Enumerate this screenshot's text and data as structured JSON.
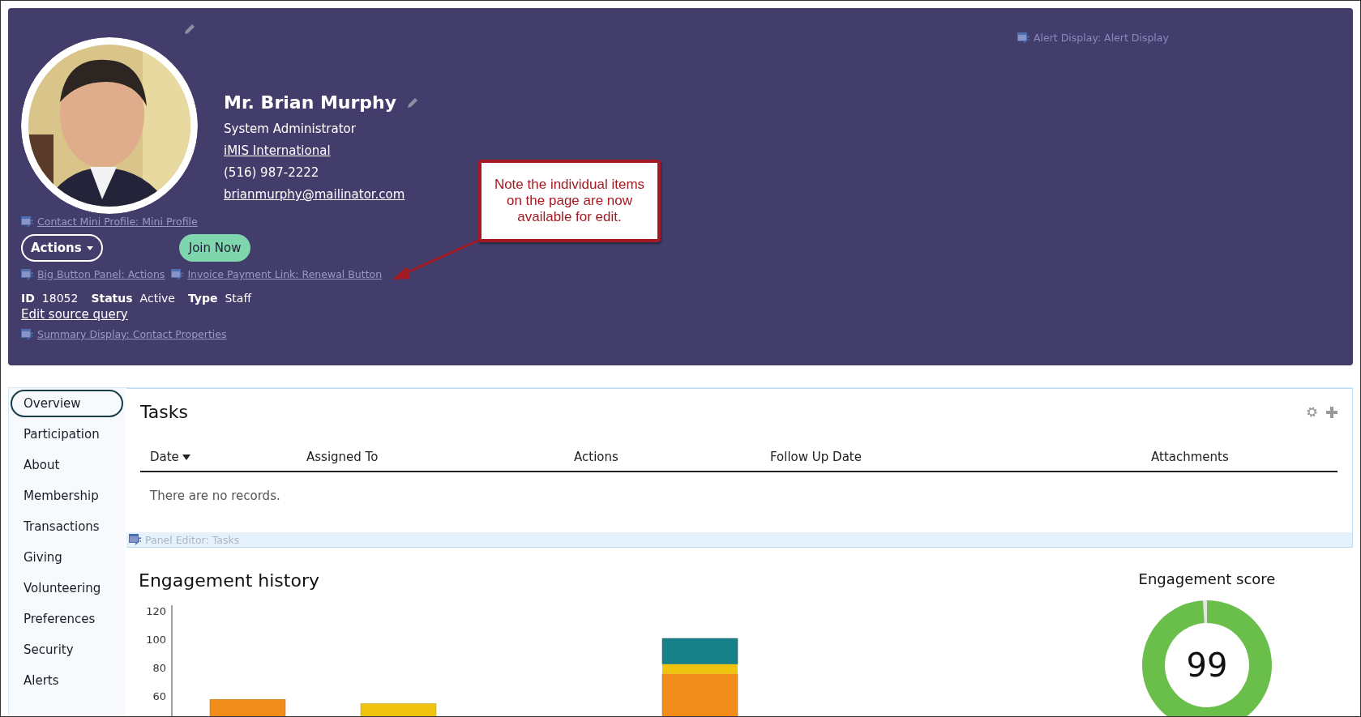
{
  "header": {
    "alert_display_link": "Alert Display: Alert Display",
    "name": "Mr. Brian Murphy",
    "job_title": "System Administrator",
    "organization": "iMIS International",
    "phone": "(516) 987-2222",
    "email": "brianmurphy@mailinator.com",
    "mini_profile_link": "Contact Mini Profile: Mini Profile",
    "actions_button": "Actions",
    "join_button": "Join Now",
    "panel_links": [
      "Big Button Panel: Actions",
      "Invoice Payment Link: Renewal Button"
    ],
    "properties": [
      {
        "label": "ID",
        "value": "18052"
      },
      {
        "label": "Status",
        "value": "Active"
      },
      {
        "label": "Type",
        "value": "Staff"
      }
    ],
    "edit_query_link": "Edit source query",
    "summary_link": "Summary Display: Contact Properties"
  },
  "callout": {
    "text": "Note the individual items on the page are now available for edit."
  },
  "nav": [
    {
      "label": "Overview",
      "selected": true
    },
    {
      "label": "Participation",
      "selected": false
    },
    {
      "label": "About",
      "selected": false
    },
    {
      "label": "Membership",
      "selected": false
    },
    {
      "label": "Transactions",
      "selected": false
    },
    {
      "label": "Giving",
      "selected": false
    },
    {
      "label": "Volunteering",
      "selected": false
    },
    {
      "label": "Preferences",
      "selected": false
    },
    {
      "label": "Security",
      "selected": false
    },
    {
      "label": "Alerts",
      "selected": false
    }
  ],
  "tasks": {
    "title": "Tasks",
    "columns": [
      {
        "label": "Date",
        "sorted": true
      },
      {
        "label": "Assigned To",
        "sorted": false
      },
      {
        "label": "Actions",
        "sorted": false
      },
      {
        "label": "Follow Up Date",
        "sorted": false
      },
      {
        "label": "Attachments",
        "sorted": false
      }
    ],
    "empty_text": "There are no records.",
    "editor_link": "Panel Editor: Tasks"
  },
  "engagement_history": {
    "title": "Engagement history",
    "axis_labels": [
      "120",
      "100",
      "80",
      "60"
    ]
  },
  "engagement_score": {
    "title": "Engagement score",
    "value": "99",
    "level": 0.99
  }
}
